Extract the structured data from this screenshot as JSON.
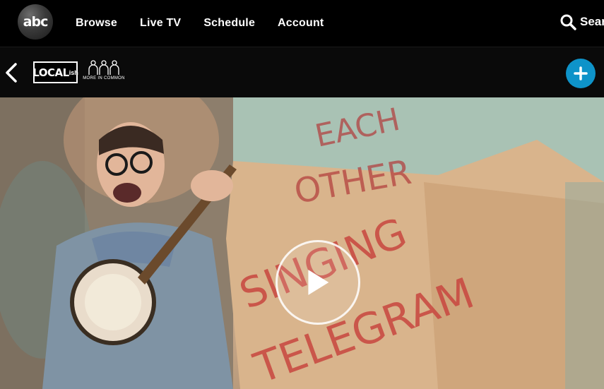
{
  "logo": {
    "text": "abc"
  },
  "nav": {
    "links": [
      "Browse",
      "Live TV",
      "Schedule",
      "Account"
    ],
    "search_label": "Search"
  },
  "show": {
    "localish_text": "LOCAL",
    "localish_sup": "ish",
    "partner_text": "MORE IN COMMON"
  },
  "video": {
    "sign_text": [
      "EACH",
      "OTHER",
      "SINGING",
      "TELEGRAM"
    ]
  },
  "colors": {
    "accent": "#0e93c9",
    "nav_bg": "#000000"
  },
  "icons": [
    "abc-logo-icon",
    "search-icon",
    "back-arrow-icon",
    "more-in-common-icon",
    "plus-icon",
    "play-icon"
  ]
}
